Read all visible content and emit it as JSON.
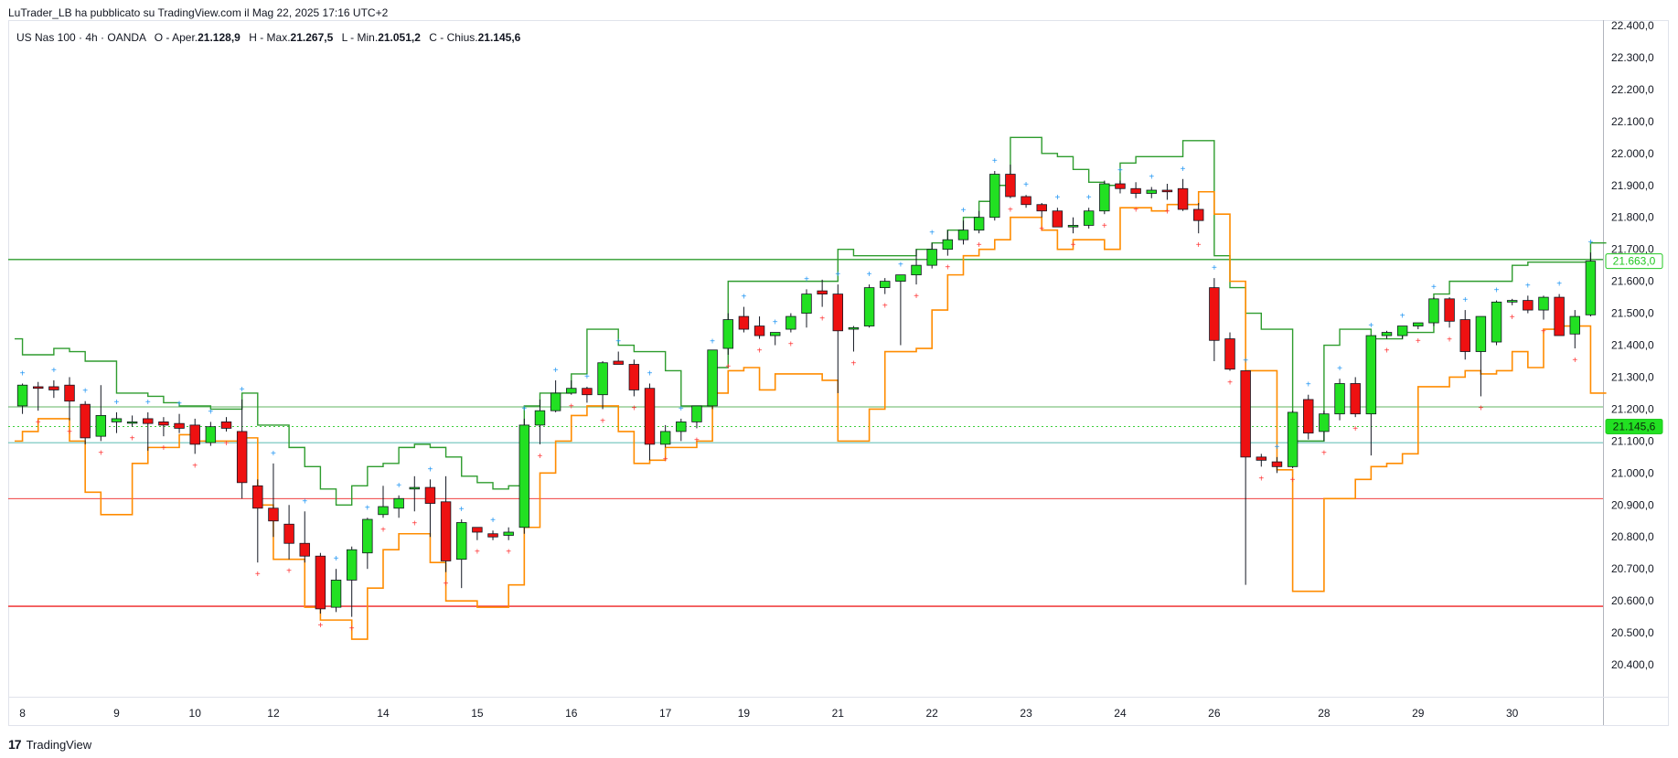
{
  "header": {
    "publisher_text": "LuTrader_LB ha pubblicato su TradingView.com il Mag 22, 2025 17:16 UTC+2"
  },
  "symbol": {
    "name": "US Nas 100 · 4h · OANDA",
    "o_label": "O",
    "aper_label": "Aper.",
    "open": "21.128,9",
    "h_label": "H",
    "max_label": "Max.",
    "high": "21.267,5",
    "l_label": "L",
    "min_label": "Min.",
    "low": "21.051,2",
    "c_label": "C",
    "chius_label": "Chius.",
    "close": "21.145,6"
  },
  "footer": {
    "logo_text": "TradingView",
    "logo_mark": "17"
  },
  "colors": {
    "bull": "#22e022",
    "bear": "#ee1111",
    "wick": "#131722",
    "upper_band": "#2e9c2e",
    "lower_band": "#ff8c00",
    "level_green": "#2e9c2e",
    "level_red": "#ee2222",
    "level_teal": "#26a69a",
    "dot_green": "#22c822",
    "cross_blue": "#2196f3",
    "cross_red": "#ff3333"
  },
  "chart_data": {
    "type": "candlestick",
    "y_axis": {
      "min": 20300,
      "max": 22400,
      "ticks": [
        "22.400,0",
        "22.300,0",
        "22.200,0",
        "22.100,0",
        "22.000,0",
        "21.900,0",
        "21.800,0",
        "21.700,0",
        "21.600,0",
        "21.500,0",
        "21.400,0",
        "21.300,0",
        "21.200,0",
        "21.100,0",
        "21.000,0",
        "20.900,0",
        "20.800,0",
        "20.700,0",
        "20.600,0",
        "20.500,0",
        "20.400,0"
      ],
      "tick_values": [
        22400,
        22300,
        22200,
        22100,
        22000,
        21900,
        21800,
        21700,
        21600,
        21500,
        21400,
        21300,
        21200,
        21100,
        21000,
        20900,
        20800,
        20700,
        20600,
        20500,
        20400
      ]
    },
    "x_axis": {
      "labels": [
        "8",
        "9",
        "10",
        "12",
        "14",
        "15",
        "16",
        "17",
        "19",
        "21",
        "22",
        "23",
        "24",
        "26",
        "28",
        "29",
        "30"
      ],
      "label_candle_index": [
        0,
        6,
        11,
        16,
        23,
        29,
        35,
        41,
        46,
        52,
        58,
        64,
        70,
        76,
        83,
        89,
        95
      ]
    },
    "price_labels": [
      {
        "value": 21663,
        "text": "21.663,0",
        "style": "outline-green"
      },
      {
        "value": 21145.6,
        "text": "21.145,6",
        "style": "filled-green"
      }
    ],
    "levels": [
      {
        "value": 21668,
        "color": "level_green",
        "width": 1.4,
        "dash": false
      },
      {
        "value": 21207,
        "color": "level_green",
        "width": 0.8,
        "dash": false
      },
      {
        "value": 21145.6,
        "color": "dot_green",
        "width": 0.8,
        "dash": true
      },
      {
        "value": 21095,
        "color": "level_teal",
        "width": 0.8,
        "dash": false
      },
      {
        "value": 20920,
        "color": "level_red",
        "width": 0.8,
        "dash": false
      },
      {
        "value": 20583,
        "color": "level_red",
        "width": 1.4,
        "dash": false
      }
    ],
    "candles": [
      [
        21210,
        21280,
        21185,
        21275
      ],
      [
        21270,
        21285,
        21195,
        21265
      ],
      [
        21270,
        21290,
        21235,
        21260
      ],
      [
        21275,
        21300,
        21165,
        21225
      ],
      [
        21215,
        21225,
        21090,
        21110
      ],
      [
        21115,
        21275,
        21100,
        21180
      ],
      [
        21160,
        21190,
        21125,
        21170
      ],
      [
        21160,
        21180,
        21145,
        21160
      ],
      [
        21170,
        21190,
        21070,
        21155
      ],
      [
        21160,
        21175,
        21115,
        21150
      ],
      [
        21155,
        21185,
        21125,
        21140
      ],
      [
        21150,
        21170,
        21060,
        21090
      ],
      [
        21095,
        21160,
        21085,
        21145
      ],
      [
        21160,
        21175,
        21130,
        21140
      ],
      [
        21130,
        21230,
        20920,
        20970
      ],
      [
        20960,
        20980,
        20720,
        20890
      ],
      [
        20890,
        21030,
        20800,
        20850
      ],
      [
        20840,
        20900,
        20730,
        20780
      ],
      [
        20780,
        20880,
        20720,
        20740
      ],
      [
        20740,
        20750,
        20560,
        20575
      ],
      [
        20580,
        20700,
        20565,
        20665
      ],
      [
        20665,
        20770,
        20550,
        20760
      ],
      [
        20750,
        20860,
        20700,
        20855
      ],
      [
        20870,
        20960,
        20860,
        20895
      ],
      [
        20890,
        20930,
        20860,
        20920
      ],
      [
        20950,
        20990,
        20880,
        20955
      ],
      [
        20955,
        20980,
        20800,
        20905
      ],
      [
        20910,
        20990,
        20690,
        20725
      ],
      [
        20730,
        20855,
        20640,
        20845
      ],
      [
        20830,
        20830,
        20790,
        20815
      ],
      [
        20810,
        20820,
        20790,
        20800
      ],
      [
        20805,
        20830,
        20790,
        20815
      ],
      [
        20830,
        21170,
        20810,
        21150
      ],
      [
        21150,
        21230,
        21090,
        21195
      ],
      [
        21195,
        21290,
        21190,
        21250
      ],
      [
        21250,
        21290,
        21245,
        21265
      ],
      [
        21265,
        21270,
        21220,
        21245
      ],
      [
        21245,
        21350,
        21200,
        21345
      ],
      [
        21350,
        21380,
        21340,
        21340
      ],
      [
        21340,
        21355,
        21240,
        21260
      ],
      [
        21265,
        21280,
        21040,
        21090
      ],
      [
        21090,
        21150,
        21080,
        21130
      ],
      [
        21130,
        21170,
        21100,
        21160
      ],
      [
        21160,
        21210,
        21140,
        21210
      ],
      [
        21210,
        21380,
        21200,
        21385
      ],
      [
        21390,
        21500,
        21370,
        21480
      ],
      [
        21490,
        21520,
        21440,
        21450
      ],
      [
        21460,
        21490,
        21420,
        21430
      ],
      [
        21430,
        21440,
        21400,
        21440
      ],
      [
        21450,
        21500,
        21440,
        21490
      ],
      [
        21500,
        21575,
        21455,
        21560
      ],
      [
        21570,
        21605,
        21520,
        21560
      ],
      [
        21560,
        21590,
        21250,
        21445
      ],
      [
        21450,
        21460,
        21380,
        21455
      ],
      [
        21460,
        21590,
        21455,
        21580
      ],
      [
        21580,
        21610,
        21560,
        21600
      ],
      [
        21600,
        21620,
        21400,
        21620
      ],
      [
        21620,
        21700,
        21590,
        21650
      ],
      [
        21650,
        21720,
        21640,
        21700
      ],
      [
        21700,
        21760,
        21680,
        21730
      ],
      [
        21730,
        21790,
        21715,
        21760
      ],
      [
        21760,
        21820,
        21750,
        21800
      ],
      [
        21800,
        21945,
        21790,
        21935
      ],
      [
        21935,
        21965,
        21860,
        21865
      ],
      [
        21865,
        21870,
        21830,
        21840
      ],
      [
        21840,
        21845,
        21800,
        21820
      ],
      [
        21820,
        21830,
        21790,
        21770
      ],
      [
        21770,
        21800,
        21750,
        21775
      ],
      [
        21775,
        21830,
        21765,
        21820
      ],
      [
        21820,
        21915,
        21810,
        21905
      ],
      [
        21905,
        21915,
        21875,
        21890
      ],
      [
        21890,
        21910,
        21860,
        21875
      ],
      [
        21875,
        21895,
        21860,
        21885
      ],
      [
        21885,
        21905,
        21855,
        21880
      ],
      [
        21890,
        21920,
        21820,
        21825
      ],
      [
        21825,
        21845,
        21750,
        21790
      ],
      [
        21580,
        21610,
        21350,
        21415
      ],
      [
        21420,
        21440,
        21320,
        21325
      ],
      [
        21320,
        21320,
        20650,
        21050
      ],
      [
        21050,
        21060,
        21020,
        21040
      ],
      [
        21035,
        21050,
        21000,
        21020
      ],
      [
        21020,
        21195,
        21015,
        21190
      ],
      [
        21230,
        21245,
        21105,
        21125
      ],
      [
        21130,
        21195,
        21100,
        21185
      ],
      [
        21185,
        21295,
        21165,
        21280
      ],
      [
        21280,
        21300,
        21175,
        21185
      ],
      [
        21185,
        21430,
        21055,
        21430
      ],
      [
        21430,
        21445,
        21420,
        21440
      ],
      [
        21430,
        21460,
        21420,
        21460
      ],
      [
        21460,
        21470,
        21450,
        21470
      ],
      [
        21470,
        21550,
        21460,
        21545
      ],
      [
        21545,
        21550,
        21455,
        21475
      ],
      [
        21480,
        21510,
        21355,
        21380
      ],
      [
        21380,
        21490,
        21240,
        21490
      ],
      [
        21410,
        21540,
        21400,
        21535
      ],
      [
        21535,
        21545,
        21525,
        21540
      ],
      [
        21540,
        21555,
        21500,
        21510
      ],
      [
        21510,
        21555,
        21480,
        21550
      ],
      [
        21550,
        21560,
        21430,
        21430
      ],
      [
        21435,
        21510,
        21390,
        21490
      ],
      [
        21495,
        21690,
        21490,
        21663
      ]
    ],
    "upper_band": [
      21420,
      21370,
      21370,
      21390,
      21380,
      21350,
      21350,
      21250,
      21250,
      21240,
      21220,
      21210,
      21210,
      21200,
      21200,
      21250,
      21150,
      21150,
      21080,
      21020,
      20950,
      20900,
      20960,
      21020,
      21030,
      21080,
      21090,
      21080,
      21050,
      20990,
      20970,
      20950,
      20960,
      21210,
      21250,
      21250,
      21310,
      21450,
      21450,
      21400,
      21380,
      21380,
      21320,
      21210,
      21210,
      21330,
      21600,
      21600,
      21600,
      21600,
      21600,
      21600,
      21600,
      21700,
      21680,
      21680,
      21680,
      21680,
      21700,
      21720,
      21760,
      21800,
      21850,
      21900,
      22050,
      22050,
      22000,
      21990,
      21950,
      21910,
      21900,
      21970,
      21990,
      21990,
      21990,
      22040,
      22040,
      21680,
      21580,
      21500,
      21450,
      21450,
      21100,
      21100,
      21400,
      21450,
      21450,
      21420,
      21420,
      21440,
      21440,
      21560,
      21600,
      21600,
      21600,
      21600,
      21650,
      21660,
      21660,
      21660,
      21660,
      21720
    ],
    "lower_band": [
      21100,
      21130,
      21170,
      21170,
      21100,
      20940,
      20870,
      20870,
      21030,
      21080,
      21080,
      21120,
      21100,
      21100,
      21100,
      21110,
      20900,
      20730,
      20730,
      20580,
      20540,
      20540,
      20480,
      20640,
      20760,
      20810,
      20810,
      20720,
      20600,
      20600,
      20580,
      20580,
      20650,
      20830,
      21000,
      21100,
      21180,
      21210,
      21210,
      21130,
      21030,
      21040,
      21080,
      21080,
      21100,
      21250,
      21320,
      21330,
      21260,
      21310,
      21310,
      21310,
      21290,
      21100,
      21100,
      21200,
      21380,
      21380,
      21390,
      21510,
      21620,
      21680,
      21700,
      21730,
      21800,
      21800,
      21760,
      21700,
      21730,
      21730,
      21700,
      21830,
      21830,
      21820,
      21840,
      21840,
      21880,
      21810,
      21600,
      21320,
      21320,
      21010,
      20630,
      20630,
      20920,
      20920,
      20980,
      21020,
      21030,
      21060,
      21270,
      21270,
      21300,
      21320,
      21310,
      21320,
      21380,
      21330,
      21450,
      21460,
      21460,
      21250
    ]
  }
}
